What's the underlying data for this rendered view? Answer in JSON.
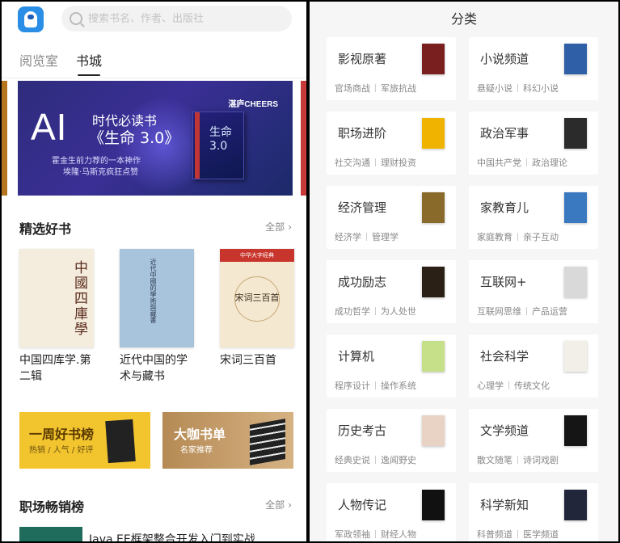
{
  "left": {
    "search_placeholder": "搜索书名、作者、出版社",
    "tabs": [
      {
        "label": "阅览室",
        "active": false
      },
      {
        "label": "书城",
        "active": true
      }
    ],
    "banner": {
      "ai": "AI",
      "line1": "时代必读书",
      "line2": "《生命 3.0》",
      "brand": "湛庐CHEERS",
      "sub1": "霍金生前力荐的一本神作",
      "sub2": "埃隆·马斯克疯狂点赞",
      "book_title": "生命3.0"
    },
    "featured": {
      "title": "精选好书",
      "more": "全部",
      "books": [
        {
          "name": "中国四库学.第二辑",
          "cover_text": "中國四庫學"
        },
        {
          "name": "近代中国的学术与藏书",
          "cover_text": "近代中國的學術與藏書"
        },
        {
          "name": "宋词三百首",
          "cover_text": "宋词三百首",
          "cover_band": "中华大字经典"
        }
      ]
    },
    "promos": [
      {
        "title": "一周好书榜",
        "sub": "热销 / 人气 / 好评"
      },
      {
        "title": "大咖书单",
        "sub": "名家推荐"
      }
    ],
    "bestsellers": {
      "title": "职场畅销榜",
      "more": "全部",
      "first_item": "Java EE框架整合开发入门到实战..."
    }
  },
  "right": {
    "title": "分类",
    "categories": [
      {
        "name": "影视原著",
        "subs": [
          "官场商战",
          "军旅抗战"
        ],
        "cover": "#7a1f1f"
      },
      {
        "name": "小说频道",
        "subs": [
          "悬疑小说",
          "科幻小说"
        ],
        "cover": "#2f5fa6"
      },
      {
        "name": "职场进阶",
        "subs": [
          "社交沟通",
          "理财投资"
        ],
        "cover": "#f0b400"
      },
      {
        "name": "政治军事",
        "subs": [
          "中国共产党",
          "政治理论"
        ],
        "cover": "#2b2b2b"
      },
      {
        "name": "经济管理",
        "subs": [
          "经济学",
          "管理学"
        ],
        "cover": "#8a6a2a"
      },
      {
        "name": "家教育儿",
        "subs": [
          "家庭教育",
          "亲子互动"
        ],
        "cover": "#3a78c0"
      },
      {
        "name": "成功励志",
        "subs": [
          "成功哲学",
          "为人处世"
        ],
        "cover": "#2a2016"
      },
      {
        "name": "互联网+",
        "subs": [
          "互联网思维",
          "产品运营"
        ],
        "cover": "#d9d9d9"
      },
      {
        "name": "计算机",
        "subs": [
          "程序设计",
          "操作系统"
        ],
        "cover": "#c6e08a"
      },
      {
        "name": "社会科学",
        "subs": [
          "心理学",
          "传统文化"
        ],
        "cover": "#f2efe8"
      },
      {
        "name": "历史考古",
        "subs": [
          "经典史说",
          "逸闻野史"
        ],
        "cover": "#e9d3c4"
      },
      {
        "name": "文学频道",
        "subs": [
          "散文随笔",
          "诗词戏剧"
        ],
        "cover": "#151515"
      },
      {
        "name": "人物传记",
        "subs": [
          "军政领袖",
          "财经人物"
        ],
        "cover": "#111111"
      },
      {
        "name": "科学新知",
        "subs": [
          "科普频道",
          "医学频道"
        ],
        "cover": "#22263a"
      }
    ]
  }
}
